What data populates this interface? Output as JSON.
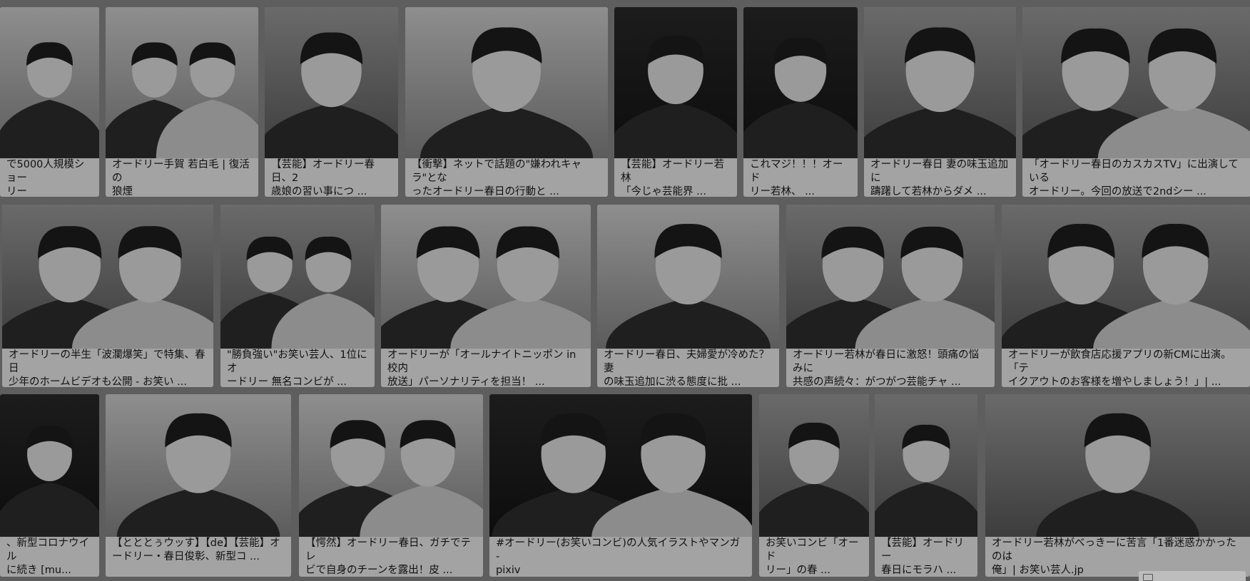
{
  "results": [
    {
      "caption": "で5000人規模ショー\nリー",
      "tone": "light",
      "people": 1
    },
    {
      "caption": "オードリー手賀 若白毛 | 復活の\n狼煙",
      "tone": "light",
      "people": 2
    },
    {
      "caption": "【芸能】オードリー春日、2\n歳娘の習い事につ ...",
      "tone": "mid",
      "people": 1
    },
    {
      "caption": "【衝撃】ネットで話題の\"嫌われキャラ\"とな\nったオードリー春日の行動と ...",
      "tone": "light",
      "people": 1
    },
    {
      "caption": "【芸能】オードリー若林\n「今じゃ芸能界 ...",
      "tone": "dark",
      "people": 1
    },
    {
      "caption": "これマジ！！！オード\nリー若林、 ...",
      "tone": "dark",
      "people": 1
    },
    {
      "caption": "オードリー春日 妻の味玉追加に\n躊躇して若林からダメ ...",
      "tone": "mid",
      "people": 1
    },
    {
      "caption": "「オードリー春日のカスカスTV」に出演している\nオードリー。今回の放送で2ndシー ...",
      "tone": "mid",
      "people": 2
    },
    {
      "caption": "オードリーの半生「波瀾爆笑」で特集、春日\n少年のホームビデオも公開 - お笑い ...",
      "tone": "mid",
      "people": 2
    },
    {
      "caption": "\"勝負強い\"お笑い芸人、1位にオ\nードリー 無名コンビが ...",
      "tone": "mid",
      "people": 2
    },
    {
      "caption": "オードリーが「オールナイトニッポン in 校内\n放送」パーソナリティを担当！ ...",
      "tone": "light",
      "people": 2
    },
    {
      "caption": "オードリー春日、夫婦愛が冷めた？妻\nの味玉追加に渋る態度に批 ...",
      "tone": "light",
      "people": 1
    },
    {
      "caption": "オードリー若林が春日に激怒！頭痛の悩みに\n共感の声続々：がつがつ芸能チャ ...",
      "tone": "mid",
      "people": 2
    },
    {
      "caption": "オードリーが飲食店応援アプリの新CMに出演。「テ\nイクアウトのお客様を増やしましょう！」| ...",
      "tone": "mid",
      "people": 2
    },
    {
      "caption": "、新型コロナウイル\nに続き [mu...",
      "tone": "dark",
      "people": 1
    },
    {
      "caption": "【とととぅウッす】【de】【芸能】オ\nードリー・春日俊彰、新型コ ...",
      "tone": "light",
      "people": 1
    },
    {
      "caption": "【愕然】オードリー春日、ガチでテレ\nビで自身のチーンを露出！皮 ...",
      "tone": "light",
      "people": 2
    },
    {
      "caption": "#オードリー(お笑いコンビ)の人気イラストやマンガ -\npixiv",
      "tone": "dark",
      "people": 2
    },
    {
      "caption": "お笑いコンビ「オード\nリー」の春 ...",
      "tone": "mid",
      "people": 1
    },
    {
      "caption": "【芸能】オードリー\n春日にモラハ ...",
      "tone": "mid",
      "people": 1
    },
    {
      "caption": "オードリー若林がべっきーに苦言「1番迷惑かかったのは\n俺」| お笑い芸人.jp",
      "tone": "mid",
      "people": 1
    }
  ]
}
